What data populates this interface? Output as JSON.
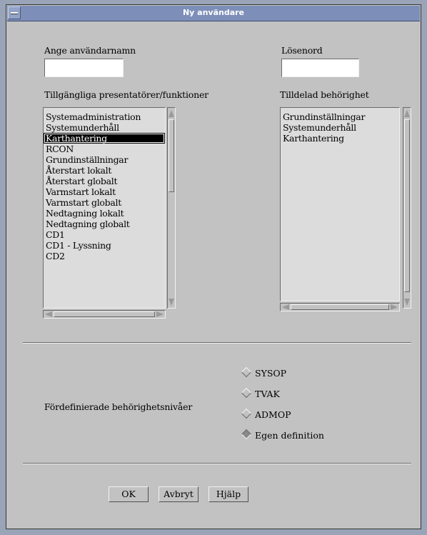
{
  "window": {
    "title": "Ny användare"
  },
  "form": {
    "username_label": "Ange användarnamn",
    "username_value": "",
    "password_label": "Lösenord",
    "password_value": ""
  },
  "available": {
    "label": "Tillgängliga presentatörer/funktioner",
    "items": [
      "Systemadministration",
      "Systemunderhåll",
      "Karthantering",
      "RCON",
      "Grundinställningar",
      "Återstart lokalt",
      "Återstart globalt",
      "Varmstart lokalt",
      "Varmstart globalt",
      "Nedtagning lokalt",
      "Nedtagning globalt",
      "CD1",
      "CD1 - Lyssning",
      "CD2"
    ],
    "selected_index": 2
  },
  "assigned": {
    "label": "Tilldelad behörighet",
    "items": [
      "Grundinställningar",
      "Systemunderhåll",
      "Karthantering"
    ]
  },
  "levels": {
    "label": "Fördefinierade behörighetsnivåer",
    "options": [
      {
        "label": "SYSOP",
        "selected": false
      },
      {
        "label": "TVAK",
        "selected": false
      },
      {
        "label": "ADMOP",
        "selected": false
      },
      {
        "label": "Egen definition",
        "selected": true
      }
    ]
  },
  "buttons": {
    "ok": "OK",
    "cancel": "Avbryt",
    "help": "Hjälp"
  }
}
